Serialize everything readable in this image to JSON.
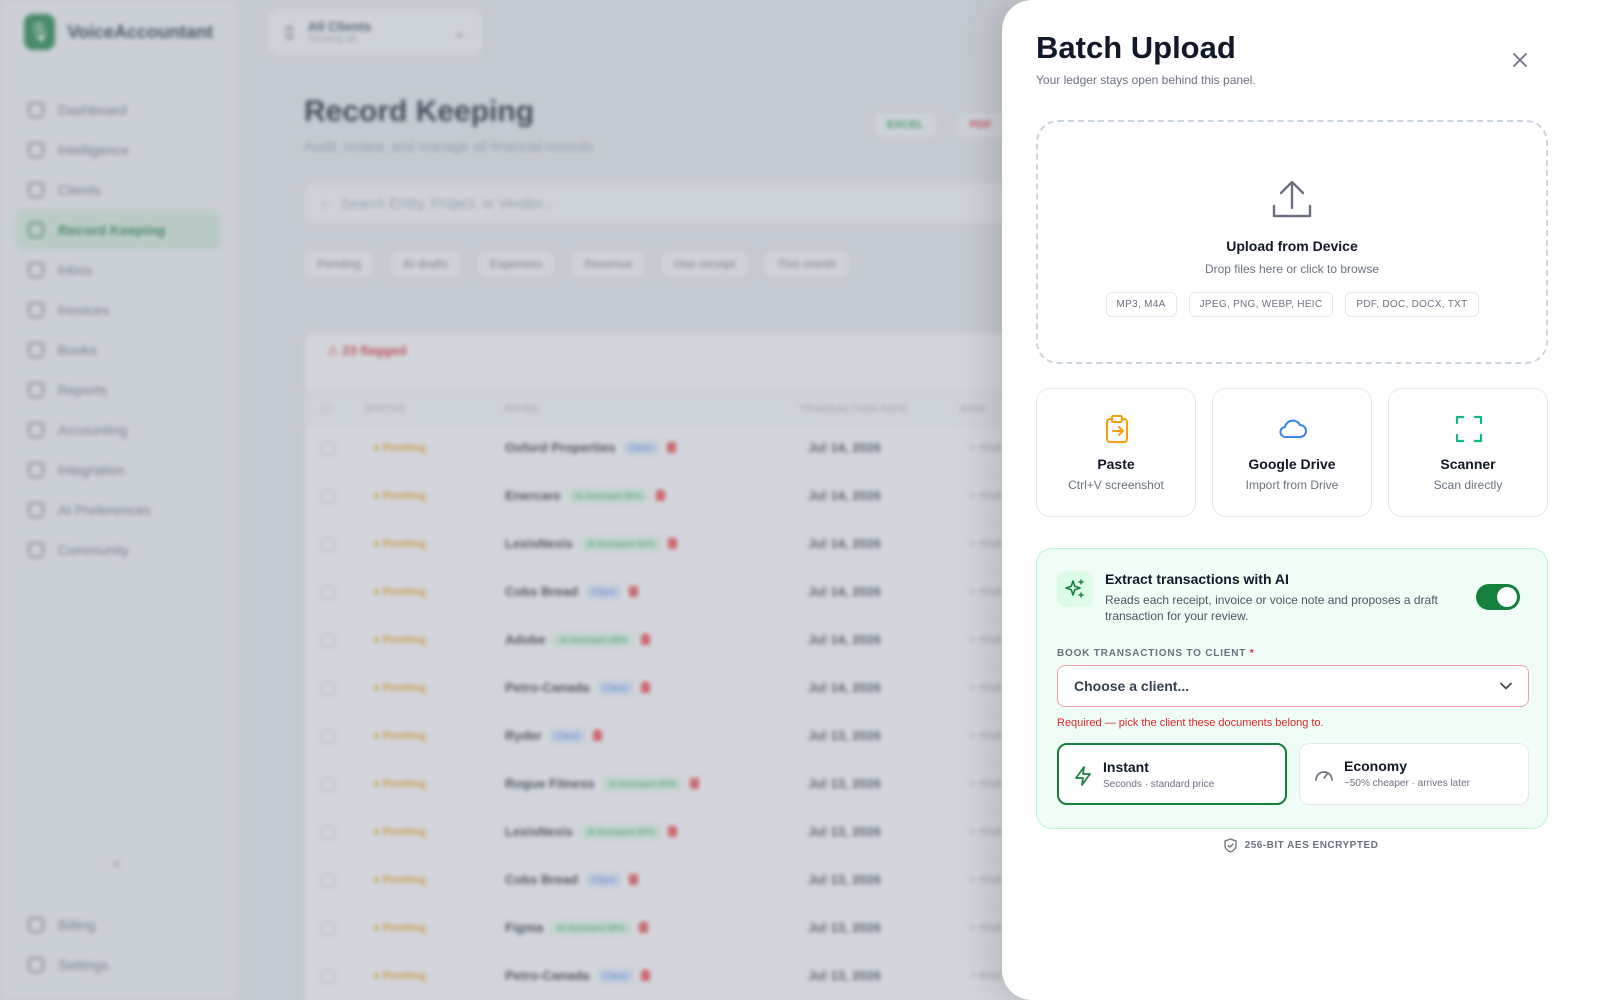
{
  "app": {
    "brand_name": "VoiceAccountant",
    "client_selector": {
      "title": "All Clients",
      "subtitle": "Viewing all"
    },
    "nav": [
      {
        "label": "Dashboard",
        "icon": "grid-icon"
      },
      {
        "label": "Intelligence",
        "icon": "bulb-icon"
      },
      {
        "label": "Clients",
        "icon": "users-icon"
      },
      {
        "label": "Record Keeping",
        "icon": "clock-icon",
        "active": true
      },
      {
        "label": "Inbox",
        "icon": "inbox-icon"
      },
      {
        "label": "Invoices",
        "icon": "invoice-icon"
      },
      {
        "label": "Books",
        "icon": "book-icon"
      },
      {
        "label": "Reports",
        "icon": "chart-icon"
      },
      {
        "label": "Accounting",
        "icon": "calculator-icon"
      },
      {
        "label": "Integration",
        "icon": "plug-icon"
      },
      {
        "label": "AI Preferences",
        "icon": "sliders-icon"
      },
      {
        "label": "Community",
        "icon": "community-icon"
      }
    ],
    "nav_bottom": [
      {
        "label": "Billing",
        "icon": "card-icon"
      },
      {
        "label": "Settings",
        "icon": "gear-icon"
      }
    ],
    "page_title": "Record Keeping",
    "page_subtitle": "Audit, review, and manage all financial records",
    "export_excel": "EXCEL",
    "export_pdf": "PDF",
    "search_placeholder": "Search Entity, Project, or Vendor...",
    "filters": [
      "Pending",
      "AI drafts",
      "Expenses",
      "Revenue",
      "Has receipt",
      "This month"
    ],
    "flag_text": "23 flagged",
    "columns": [
      "STATUS",
      "PAYEE",
      "TRANSACTION DATE",
      "KIND"
    ],
    "rows": [
      {
        "status": "Pending",
        "payee": "Oxford Properties",
        "tag": "Client",
        "tag_type": "client",
        "date": "Jul 14, 2026",
        "kind": "+ Kind"
      },
      {
        "status": "Pending",
        "payee": "Enercare",
        "tag": "AI Assistant 95%",
        "tag_type": "ai",
        "date": "Jul 14, 2026",
        "kind": "+ Kind"
      },
      {
        "status": "Pending",
        "payee": "LexisNexis",
        "tag": "AI Assistant 92%",
        "tag_type": "ai",
        "date": "Jul 14, 2026",
        "kind": "+ Kind"
      },
      {
        "status": "Pending",
        "payee": "Cobs Bread",
        "tag": "Client",
        "tag_type": "client",
        "date": "Jul 14, 2026",
        "kind": "+ Kind"
      },
      {
        "status": "Pending",
        "payee": "Adobe",
        "tag": "AI Assistant 98%",
        "tag_type": "ai",
        "date": "Jul 14, 2026",
        "kind": "+ Kind"
      },
      {
        "status": "Pending",
        "payee": "Petro-Canada",
        "tag": "Client",
        "tag_type": "client",
        "date": "Jul 14, 2026",
        "kind": "+ Kind"
      },
      {
        "status": "Pending",
        "payee": "Ryder",
        "tag": "Client",
        "tag_type": "client",
        "date": "Jul 13, 2026",
        "kind": "+ Kind"
      },
      {
        "status": "Pending",
        "payee": "Rogue Fitness",
        "tag": "AI Assistant 95%",
        "tag_type": "ai",
        "date": "Jul 13, 2026",
        "kind": "+ Kind"
      },
      {
        "status": "Pending",
        "payee": "LexisNexis",
        "tag": "AI Assistant 90%",
        "tag_type": "ai",
        "date": "Jul 13, 2026",
        "kind": "+ Kind"
      },
      {
        "status": "Pending",
        "payee": "Cobs Bread",
        "tag": "Client",
        "tag_type": "client",
        "date": "Jul 13, 2026",
        "kind": "+ Kind"
      },
      {
        "status": "Pending",
        "payee": "Figma",
        "tag": "AI Assistant 98%",
        "tag_type": "ai",
        "date": "Jul 13, 2026",
        "kind": "+ Kind"
      },
      {
        "status": "Pending",
        "payee": "Petro-Canada",
        "tag": "Client",
        "tag_type": "client",
        "date": "Jul 13, 2026",
        "kind": "+ Kind"
      }
    ]
  },
  "panel": {
    "title": "Batch Upload",
    "subtitle": "Your ledger stays open behind this panel.",
    "dropzone": {
      "title": "Upload from Device",
      "subtitle": "Drop files here or click to browse",
      "formats": [
        "MP3, M4A",
        "JPEG, PNG, WEBP, HEIC",
        "PDF, DOC, DOCX, TXT"
      ]
    },
    "sources": [
      {
        "title": "Paste",
        "subtitle": "Ctrl+V screenshot",
        "icon": "clipboard-icon",
        "color": "#f59e0b"
      },
      {
        "title": "Google Drive",
        "subtitle": "Import from Drive",
        "icon": "cloud-icon",
        "color": "#3b82f6"
      },
      {
        "title": "Scanner",
        "subtitle": "Scan directly",
        "icon": "scan-icon",
        "color": "#10b981"
      }
    ],
    "ai": {
      "title": "Extract transactions with AI",
      "description": "Reads each receipt, invoice or voice note and proposes a draft transaction for your review.",
      "enabled": true,
      "client_label": "BOOK TRANSACTIONS TO CLIENT",
      "required_mark": "*",
      "client_value": "Choose a client...",
      "client_error": "Required — pick the client these documents belong to.",
      "speed_options": [
        {
          "title": "Instant",
          "subtitle": "Seconds · standard price",
          "icon": "bolt-icon",
          "selected": true
        },
        {
          "title": "Economy",
          "subtitle": "~50% cheaper · arrives later",
          "icon": "gauge-icon",
          "selected": false
        }
      ]
    },
    "encryption": "256-BIT AES ENCRYPTED"
  },
  "colors": {
    "brand": "#15803d",
    "accent_amber": "#f59e0b",
    "accent_blue": "#3b82f6",
    "accent_teal": "#10b981",
    "error": "#dc2626"
  }
}
